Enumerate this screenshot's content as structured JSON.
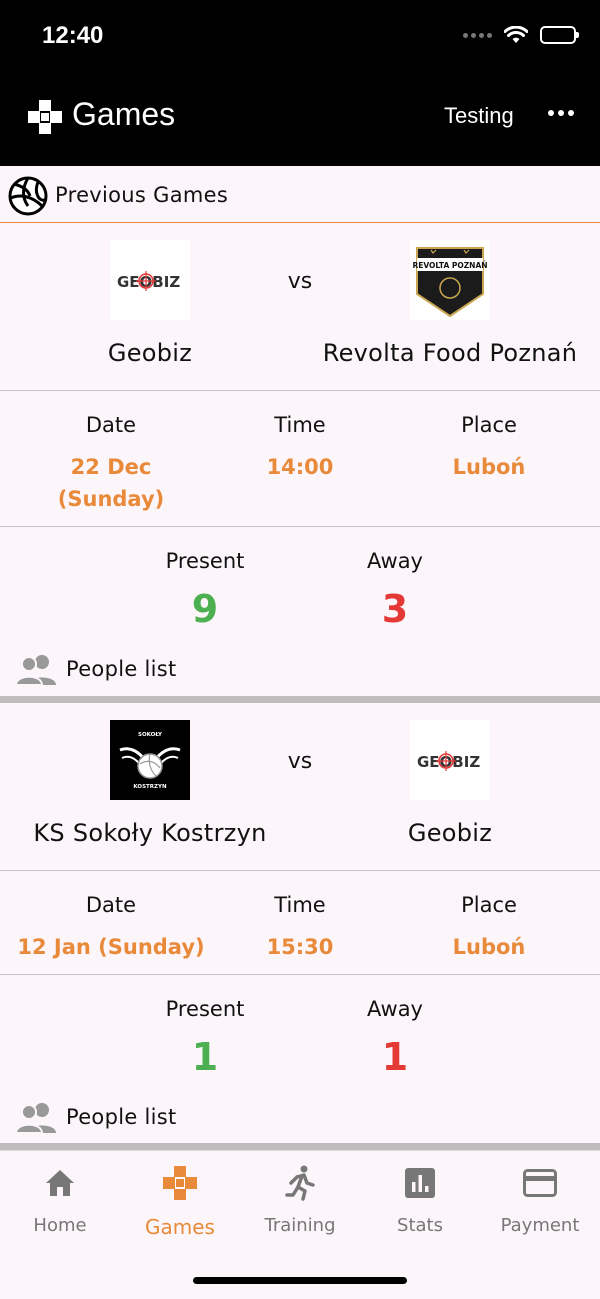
{
  "status": {
    "time": "12:40"
  },
  "appbar": {
    "title": "Games",
    "action": "Testing"
  },
  "section": {
    "title": "Previous Games"
  },
  "labels": {
    "vs": "vs",
    "date": "Date",
    "time": "Time",
    "place": "Place",
    "present": "Present",
    "away": "Away",
    "people_list": "People list"
  },
  "games": [
    {
      "home": {
        "name": "Geobiz",
        "logo_text": "GEOBIZ"
      },
      "away": {
        "name": "Revolta Food Poznań",
        "logo_text": "REVOLTA POZNAŃ"
      },
      "date_line1": "22 Dec",
      "date_line2": "(Sunday)",
      "time": "14:00",
      "place": "Luboń",
      "present": "9",
      "absent": "3"
    },
    {
      "home": {
        "name": "KS Sokoły Kostrzyn",
        "logo_text": "SOKOŁY KOSTRZYN"
      },
      "away": {
        "name": "Geobiz",
        "logo_text": "GEOBIZ"
      },
      "date_line1": "12 Jan (Sunday)",
      "date_line2": "",
      "time": "15:30",
      "place": "Luboń",
      "present": "1",
      "absent": "1"
    }
  ],
  "tabs": [
    {
      "label": "Home",
      "icon": "home-icon"
    },
    {
      "label": "Games",
      "icon": "gamepad-icon"
    },
    {
      "label": "Training",
      "icon": "running-icon"
    },
    {
      "label": "Stats",
      "icon": "stats-icon"
    },
    {
      "label": "Payment",
      "icon": "card-icon"
    }
  ],
  "colors": {
    "accent": "#e88a3a",
    "present": "#4caf50",
    "away": "#e53935",
    "bar": "#000000"
  }
}
